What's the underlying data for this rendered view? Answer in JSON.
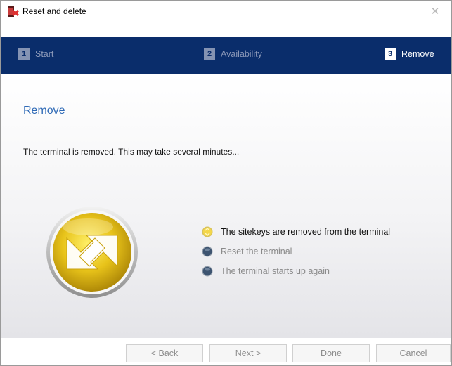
{
  "window": {
    "title": "Reset and delete",
    "close_glyph": "✕",
    "app_icon": "reset-delete-app-icon"
  },
  "steps": [
    {
      "number": "1",
      "label": "Start",
      "state": "inactive"
    },
    {
      "number": "2",
      "label": "Availability",
      "state": "inactive"
    },
    {
      "number": "3",
      "label": "Remove",
      "state": "active"
    }
  ],
  "content": {
    "heading": "Remove",
    "description": "The terminal is removed. This may take several minutes...",
    "illustration_icon": "swap-arrows-icon"
  },
  "status": [
    {
      "label": "The sitekeys are removed from the terminal",
      "state": "done"
    },
    {
      "label": "Reset the terminal",
      "state": "pending"
    },
    {
      "label": "The terminal starts up again",
      "state": "pending"
    }
  ],
  "buttons": {
    "back": "< Back",
    "next": "Next >",
    "done": "Done",
    "cancel": "Cancel"
  },
  "colors": {
    "header_bg": "#0a2d6b",
    "heading": "#2f6ab6",
    "active_bullet": "#f0c419",
    "pending_bullet": "#3d5470"
  }
}
